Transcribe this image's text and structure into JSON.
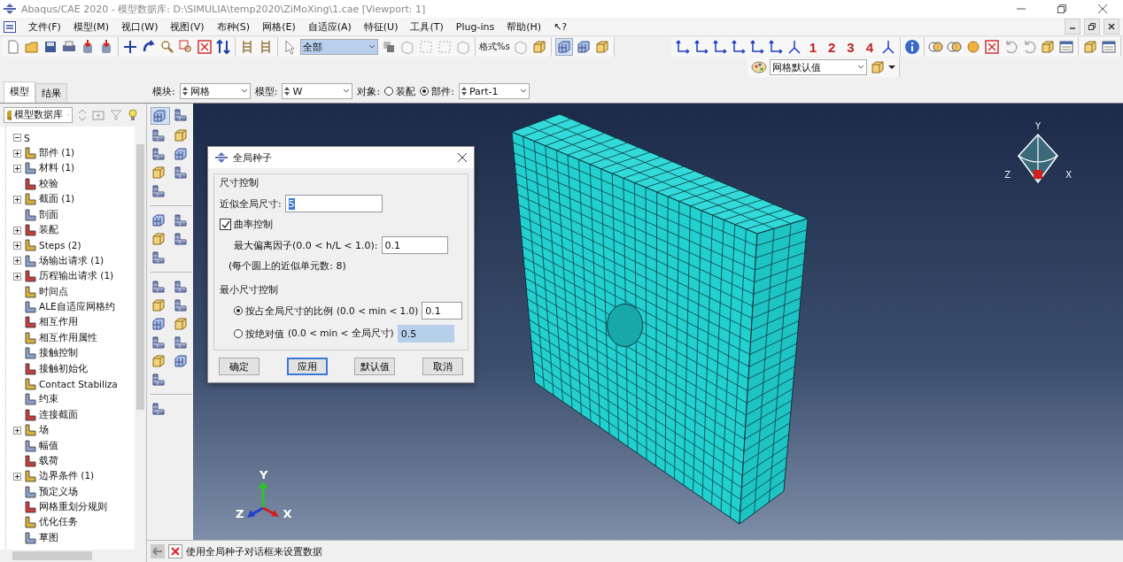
{
  "window": {
    "title": "Abaqus/CAE 2020 - 模型数据库: D:\\SIMULIA\\temp2020\\ZiMoXing\\1.cae [Viewport: 1]"
  },
  "menu": [
    "文件(F)",
    "模型(M)",
    "视口(W)",
    "视图(V)",
    "布种(S)",
    "网格(E)",
    "自适应(A)",
    "特征(U)",
    "工具(T)",
    "Plug-ins",
    "帮助(H)",
    "↖?"
  ],
  "toolbar": {
    "selection_filter": "全部",
    "format_label": "格式%s",
    "viewport_numbers": [
      "1",
      "2",
      "3",
      "4"
    ],
    "render_style": "网格默认值"
  },
  "tabs": [
    {
      "label": "模型",
      "selected": true
    },
    {
      "label": "结果",
      "selected": false
    }
  ],
  "context_bar": {
    "module_label": "模块:",
    "module": "网格",
    "model_label": "模型:",
    "model": "W",
    "object_label": "对象:",
    "objects": [
      {
        "label": "装配",
        "selected": false
      },
      {
        "label": "部件:",
        "selected": true
      }
    ],
    "part": "Part-1"
  },
  "model_tree": {
    "selector": "模型数据库",
    "root": {
      "label": "S",
      "expanded": true,
      "children": [
        {
          "label": "部件 (1)",
          "kind": "group"
        },
        {
          "label": "材料 (1)",
          "kind": "group"
        },
        {
          "label": "校验",
          "kind": "leaf"
        },
        {
          "label": "截面 (1)",
          "kind": "group"
        },
        {
          "label": "剖面",
          "kind": "leaf"
        },
        {
          "label": "装配",
          "kind": "group"
        },
        {
          "label": "Steps (2)",
          "kind": "group"
        },
        {
          "label": "场输出请求 (1)",
          "kind": "group"
        },
        {
          "label": "历程输出请求 (1)",
          "kind": "group"
        },
        {
          "label": "时间点",
          "kind": "leaf"
        },
        {
          "label": "ALE自适应网格约",
          "kind": "leaf"
        },
        {
          "label": "相互作用",
          "kind": "leaf"
        },
        {
          "label": "相互作用属性",
          "kind": "leaf"
        },
        {
          "label": "接触控制",
          "kind": "leaf"
        },
        {
          "label": "接触初始化",
          "kind": "leaf"
        },
        {
          "label": "Contact Stabiliza",
          "kind": "leaf"
        },
        {
          "label": "约束",
          "kind": "leaf"
        },
        {
          "label": "连接截面",
          "kind": "leaf"
        },
        {
          "label": "场",
          "kind": "group"
        },
        {
          "label": "幅值",
          "kind": "leaf"
        },
        {
          "label": "载荷",
          "kind": "leaf"
        },
        {
          "label": "边界条件 (1)",
          "kind": "group"
        },
        {
          "label": "预定义场",
          "kind": "leaf"
        },
        {
          "label": "网格重划分规则",
          "kind": "leaf"
        },
        {
          "label": "优化任务",
          "kind": "leaf"
        },
        {
          "label": "草图",
          "kind": "leaf"
        }
      ]
    }
  },
  "dialog": {
    "title": "全局种子",
    "size_group": "尺寸控制",
    "global_size_label": "近似全局尺寸:",
    "global_size": "5",
    "curvature": {
      "label": "曲率控制",
      "checked": true
    },
    "deviation_label": "最大偏离因子(0.0 < h/L < 1.0):",
    "deviation": "0.1",
    "elements_note": "(每个圆上的近似单元数: 8)",
    "min_size": {
      "label": "最小尺寸控制",
      "options": [
        {
          "label": "按占全局尺寸的比例",
          "range": "(0.0 < min < 1.0)",
          "value": "0.1",
          "selected": true
        },
        {
          "label": "按绝对值",
          "range": "(0.0 < min < 全局尺寸)",
          "value": "0.5",
          "selected": false
        }
      ]
    },
    "buttons": [
      {
        "label": "确定",
        "focused": false
      },
      {
        "label": "应用",
        "focused": true
      },
      {
        "label": "默认值",
        "focused": false
      },
      {
        "label": "取消",
        "focused": false
      }
    ]
  },
  "viewport": {
    "view_triad": [
      "Y",
      "Z",
      "X"
    ],
    "axis_triad": [
      "Y",
      "Z",
      "X"
    ]
  },
  "prompt": "使用全局种子对话框来设置数据"
}
